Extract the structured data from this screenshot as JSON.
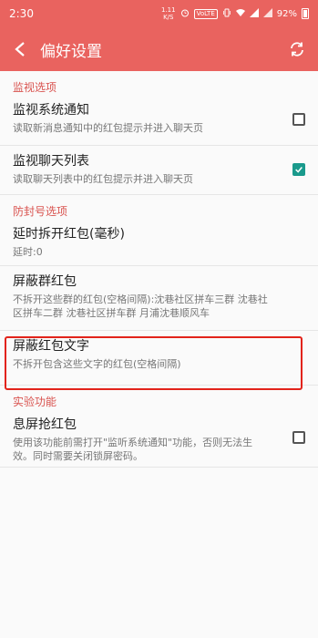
{
  "status_bar": {
    "time": "2:30",
    "net_speed": "1.11",
    "net_unit": "K/S",
    "volte": "VoLTE",
    "battery": "92%"
  },
  "app_bar": {
    "title": "偏好设置",
    "back_icon": "chevron-left-icon",
    "refresh_icon": "refresh-icon"
  },
  "sections": [
    {
      "header": "监视选项",
      "items": [
        {
          "title": "监视系统通知",
          "desc": "读取新消息通知中的红包提示并进入聊天页",
          "checked": false
        },
        {
          "title": "监视聊天列表",
          "desc": "读取聊天列表中的红包提示并进入聊天页",
          "checked": true
        }
      ]
    },
    {
      "header": "防封号选项",
      "items": [
        {
          "title": "延时拆开红包(毫秒)",
          "desc": "延时:0"
        },
        {
          "title": "屏蔽群红包",
          "desc": "不拆开这些群的红包(空格间隔):沈巷社区拼车三群 沈巷社区拼车二群 沈巷社区拼车群 月浦沈巷顺风车"
        },
        {
          "title": "屏蔽红包文字",
          "desc": "不拆开包含这些文字的红包(空格间隔)"
        }
      ]
    },
    {
      "header": "实验功能",
      "items": [
        {
          "title": "息屏抢红包",
          "desc": "使用该功能前需打开\"监听系统通知\"功能，否则无法生效。同时需要关闭锁屏密码。",
          "checked": false
        }
      ]
    }
  ],
  "colors": {
    "primary": "#e9635f",
    "accent": "#1a9a8c",
    "section_header": "#d9534f",
    "highlight_box": "#e2231a"
  }
}
